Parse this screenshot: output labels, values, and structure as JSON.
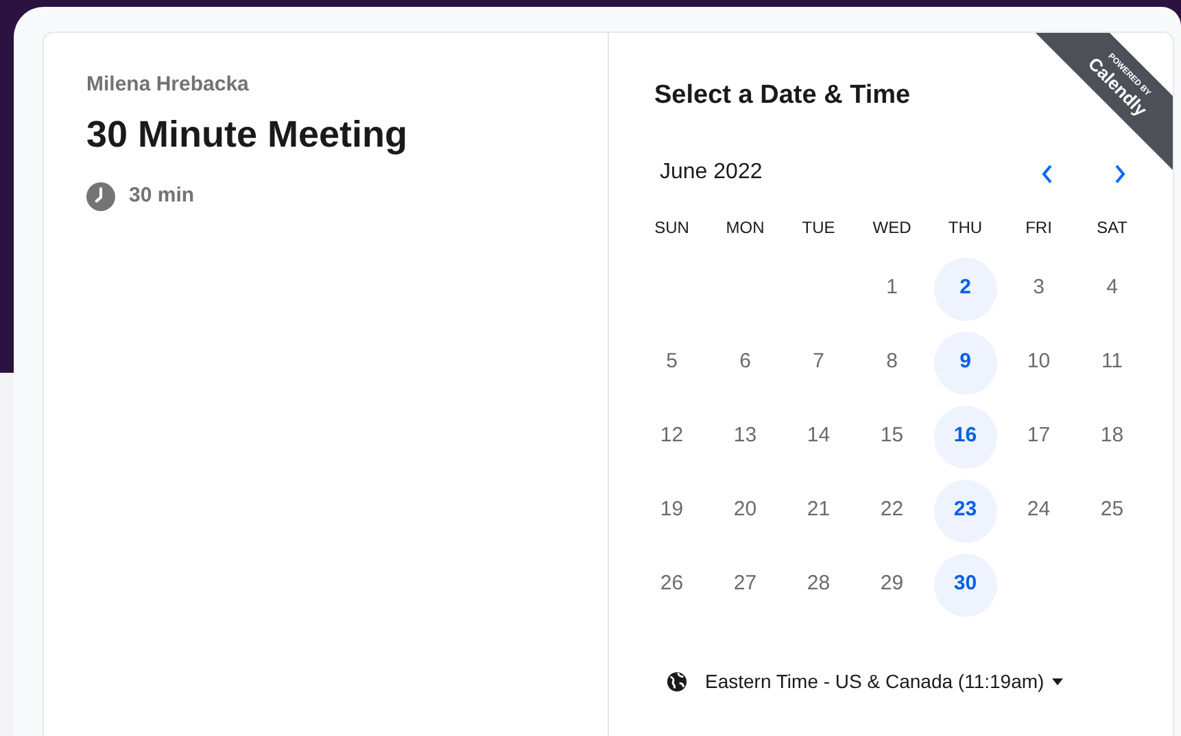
{
  "event": {
    "host": "Milena Hrebacka",
    "title": "30 Minute Meeting",
    "duration": "30 min"
  },
  "ribbon": {
    "caption": "POWERED BY",
    "brand": "Calendly"
  },
  "calendar": {
    "heading": "Select a Date & Time",
    "month": "June 2022",
    "weekdays": [
      "SUN",
      "MON",
      "TUE",
      "WED",
      "THU",
      "FRI",
      "SAT"
    ],
    "weeks": [
      [
        {
          "kind": "blank"
        },
        {
          "kind": "blank"
        },
        {
          "kind": "blank"
        },
        {
          "kind": "day",
          "label": "1",
          "available": false
        },
        {
          "kind": "day",
          "label": "2",
          "available": true
        },
        {
          "kind": "day",
          "label": "3",
          "available": false
        },
        {
          "kind": "day",
          "label": "4",
          "available": false
        }
      ],
      [
        {
          "kind": "day",
          "label": "5",
          "available": false
        },
        {
          "kind": "day",
          "label": "6",
          "available": false
        },
        {
          "kind": "day",
          "label": "7",
          "available": false
        },
        {
          "kind": "day",
          "label": "8",
          "available": false
        },
        {
          "kind": "day",
          "label": "9",
          "available": true
        },
        {
          "kind": "day",
          "label": "10",
          "available": false
        },
        {
          "kind": "day",
          "label": "11",
          "available": false
        }
      ],
      [
        {
          "kind": "day",
          "label": "12",
          "available": false
        },
        {
          "kind": "day",
          "label": "13",
          "available": false
        },
        {
          "kind": "day",
          "label": "14",
          "available": false
        },
        {
          "kind": "day",
          "label": "15",
          "available": false
        },
        {
          "kind": "day",
          "label": "16",
          "available": true
        },
        {
          "kind": "day",
          "label": "17",
          "available": false
        },
        {
          "kind": "day",
          "label": "18",
          "available": false
        }
      ],
      [
        {
          "kind": "day",
          "label": "19",
          "available": false
        },
        {
          "kind": "day",
          "label": "20",
          "available": false
        },
        {
          "kind": "day",
          "label": "21",
          "available": false
        },
        {
          "kind": "day",
          "label": "22",
          "available": false
        },
        {
          "kind": "day",
          "label": "23",
          "available": true
        },
        {
          "kind": "day",
          "label": "24",
          "available": false
        },
        {
          "kind": "day",
          "label": "25",
          "available": false
        }
      ],
      [
        {
          "kind": "day",
          "label": "26",
          "available": false
        },
        {
          "kind": "day",
          "label": "27",
          "available": false
        },
        {
          "kind": "day",
          "label": "28",
          "available": false
        },
        {
          "kind": "day",
          "label": "29",
          "available": false
        },
        {
          "kind": "day",
          "label": "30",
          "available": true
        }
      ]
    ],
    "timezone": "Eastern Time - US & Canada (11:19am)"
  }
}
